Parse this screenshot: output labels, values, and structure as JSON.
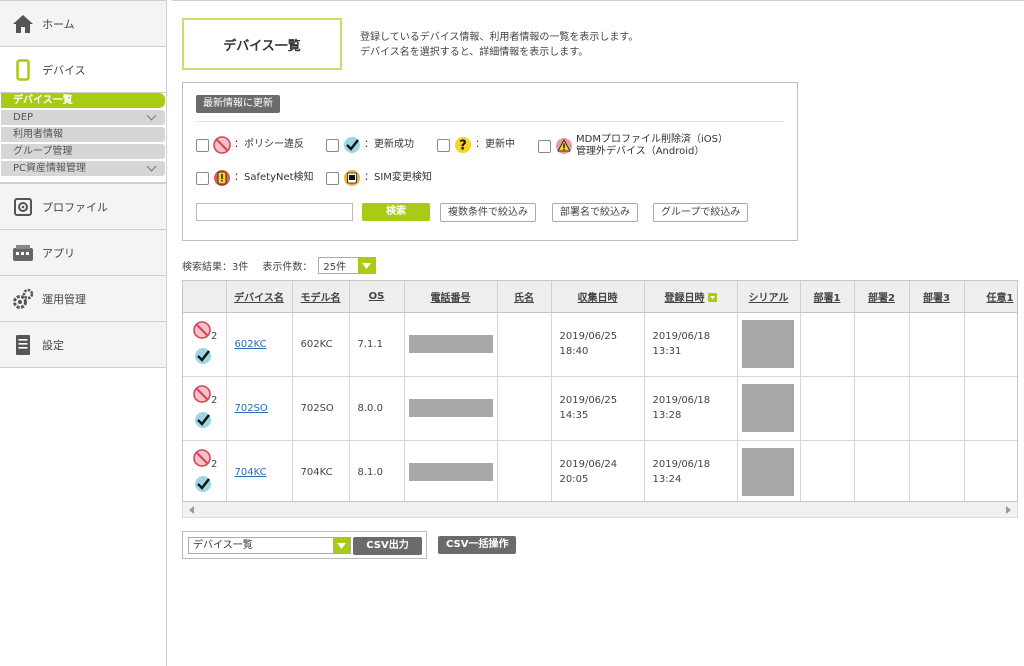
{
  "sidebar": {
    "home": "ホーム",
    "device": "デバイス",
    "sub_items": [
      {
        "label": "デバイス一覧"
      },
      {
        "label": "DEP"
      },
      {
        "label": "利用者情報"
      },
      {
        "label": "グループ管理"
      },
      {
        "label": "PC資産情報管理"
      }
    ],
    "profile": "プロファイル",
    "app": "アプリ",
    "operation": "運用管理",
    "settings": "設定"
  },
  "page": {
    "title": "デバイス一覧",
    "desc_line1": "登録しているデバイス情報、利用者情報の一覧を表示します。",
    "desc_line2": "デバイス名を選択すると、詳細情報を表示します。"
  },
  "filter": {
    "refresh_label": "最新情報に更新",
    "checks": {
      "policy": "：ポリシー違反",
      "success": "：更新成功",
      "updating": "：更新中",
      "mdm_line1": "MDMプロファイル削除済（iOS）",
      "mdm_line2": "管理外デバイス（Android）",
      "safetynet": "：SafetyNet検知",
      "sim": "：SIM変更検知"
    },
    "search_value": "",
    "search_label": "検索",
    "multi_label": "複数条件で絞込み",
    "dept_label": "部署名で絞込み",
    "group_label": "グループで絞込み"
  },
  "results": {
    "count_text": "検索結果：3件",
    "perpage_label": "表示件数：",
    "perpage_value": "25件"
  },
  "table": {
    "headers": {
      "device": "デバイス名",
      "model": "モデル名",
      "os": "OS",
      "phone": "電話番号",
      "name": "氏名",
      "collected": "収集日時",
      "registered": "登録日時",
      "serial": "シリアル",
      "dept1": "部署1",
      "dept2": "部署2",
      "dept3": "部署3",
      "opt1": "任意1"
    },
    "rows": [
      {
        "badge": "2",
        "device": "602KC",
        "model": "602KC",
        "os": "7.1.1",
        "collected_date": "2019/06/25",
        "collected_time": "18:40",
        "registered_date": "2019/06/18",
        "registered_time": "13:31"
      },
      {
        "badge": "2",
        "device": "702SO",
        "model": "702SO",
        "os": "8.0.0",
        "collected_date": "2019/06/25",
        "collected_time": "14:35",
        "registered_date": "2019/06/18",
        "registered_time": "13:28"
      },
      {
        "badge": "2",
        "device": "704KC",
        "model": "704KC",
        "os": "8.1.0",
        "collected_date": "2019/06/24",
        "collected_time": "20:05",
        "registered_date": "2019/06/18",
        "registered_time": "13:24"
      }
    ]
  },
  "export": {
    "select_value": "デバイス一覧",
    "csv_label": "CSV出力",
    "csv_bulk_label": "CSV一括操作"
  },
  "colors": {
    "accent": "#a8cc14",
    "dark_button": "#6b6b6b",
    "link": "#2b6bb3"
  }
}
